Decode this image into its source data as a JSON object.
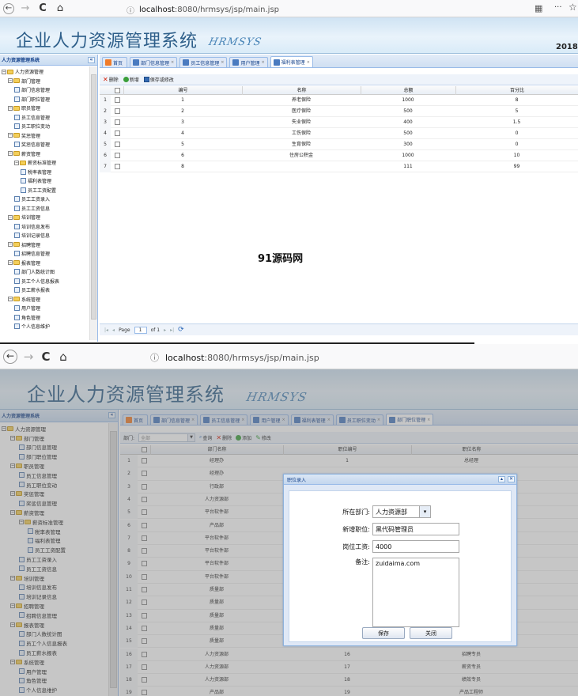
{
  "browser": {
    "back": "←",
    "forward": "→",
    "reload": "C",
    "home": "⌂",
    "url_host": "localhost",
    "url_path": ":8080/hrmsys/jsp/main.jsp",
    "qr": "▦",
    "menu": "···",
    "star": "☆",
    "info": "ⓘ"
  },
  "app": {
    "title": "企业人力资源管理系统",
    "logo": "HRMSYS",
    "year": "2018"
  },
  "sidebar": {
    "header": "人力资源管理系统",
    "collapse": "«",
    "tree": [
      {
        "label": "人力资源管理",
        "level": 0,
        "type": "folder"
      },
      {
        "label": "部门管理",
        "level": 1,
        "type": "folder"
      },
      {
        "label": "部门信息管理",
        "level": 2,
        "type": "leaf"
      },
      {
        "label": "部门职位管理",
        "level": 2,
        "type": "leaf"
      },
      {
        "label": "职员管理",
        "level": 1,
        "type": "folder"
      },
      {
        "label": "员工信息管理",
        "level": 2,
        "type": "leaf"
      },
      {
        "label": "员工职位变动",
        "level": 2,
        "type": "leaf"
      },
      {
        "label": "奖惩管理",
        "level": 1,
        "type": "folder"
      },
      {
        "label": "奖惩信息管理",
        "level": 2,
        "type": "leaf"
      },
      {
        "label": "薪资管理",
        "level": 1,
        "type": "folder"
      },
      {
        "label": "薪资标准管理",
        "level": 2,
        "type": "folder"
      },
      {
        "label": "税率表管理",
        "level": 3,
        "type": "leaf"
      },
      {
        "label": "福利表管理",
        "level": 3,
        "type": "leaf"
      },
      {
        "label": "员工工资配置",
        "level": 3,
        "type": "leaf"
      },
      {
        "label": "员工工资录入",
        "level": 2,
        "type": "leaf"
      },
      {
        "label": "员工工资信息",
        "level": 2,
        "type": "leaf"
      },
      {
        "label": "培训管理",
        "level": 1,
        "type": "folder"
      },
      {
        "label": "培训信息发布",
        "level": 2,
        "type": "leaf"
      },
      {
        "label": "培训记录信息",
        "level": 2,
        "type": "leaf"
      },
      {
        "label": "招聘管理",
        "level": 1,
        "type": "folder"
      },
      {
        "label": "招聘信息管理",
        "level": 2,
        "type": "leaf"
      },
      {
        "label": "报表管理",
        "level": 1,
        "type": "folder"
      },
      {
        "label": "部门人数统计图",
        "level": 2,
        "type": "leaf"
      },
      {
        "label": "员工个人信息报表",
        "level": 2,
        "type": "leaf"
      },
      {
        "label": "员工薪水报表",
        "level": 2,
        "type": "leaf"
      },
      {
        "label": "系统管理",
        "level": 1,
        "type": "folder"
      },
      {
        "label": "用户管理",
        "level": 2,
        "type": "leaf"
      },
      {
        "label": "角色管理",
        "level": 2,
        "type": "leaf"
      },
      {
        "label": "个人信息维护",
        "level": 2,
        "type": "leaf"
      }
    ]
  },
  "screen1": {
    "tabs": [
      {
        "label": "首页",
        "close": ""
      },
      {
        "label": "部门信息管理",
        "close": "×"
      },
      {
        "label": "员工信息管理",
        "close": "×"
      },
      {
        "label": "用户管理",
        "close": "×"
      },
      {
        "label": "福利表管理",
        "close": "×"
      }
    ],
    "toolbar": {
      "delete": "删除",
      "add": "新增",
      "save": "保存或修改"
    },
    "columns": [
      "编号",
      "名称",
      "总额",
      "百分比"
    ],
    "rows": [
      {
        "n": "1",
        "id": "1",
        "name": "养老保险",
        "total": "1000",
        "pct": "8"
      },
      {
        "n": "2",
        "id": "2",
        "name": "医疗保险",
        "total": "500",
        "pct": "5"
      },
      {
        "n": "3",
        "id": "3",
        "name": "失业保险",
        "total": "400",
        "pct": "1.5"
      },
      {
        "n": "4",
        "id": "4",
        "name": "工伤保险",
        "total": "500",
        "pct": "0"
      },
      {
        "n": "5",
        "id": "5",
        "name": "生育保险",
        "total": "300",
        "pct": "0"
      },
      {
        "n": "6",
        "id": "6",
        "name": "住房公积金",
        "total": "1000",
        "pct": "10"
      },
      {
        "n": "7",
        "id": "8",
        "name": "",
        "total": "111",
        "pct": "99"
      }
    ],
    "pager": {
      "first": "|◂",
      "prev": "◂",
      "page_label": "Page",
      "page": "1",
      "of": "of 1",
      "next": "▸",
      "last": "▸|",
      "refresh": "⟳"
    }
  },
  "watermark": "91源码网",
  "screen2": {
    "tabs": [
      {
        "label": "首页",
        "close": ""
      },
      {
        "label": "部门信息管理",
        "close": "×"
      },
      {
        "label": "员工信息管理",
        "close": "×"
      },
      {
        "label": "用户管理",
        "close": "×"
      },
      {
        "label": "福利表管理",
        "close": "×"
      },
      {
        "label": "员工职位变动",
        "close": "×"
      },
      {
        "label": "部门职位管理",
        "close": "×"
      }
    ],
    "toolbar": {
      "dept_label": "部门:",
      "dept_value": "全部",
      "query": "查询",
      "delete": "删除",
      "add": "添加",
      "edit": "修改"
    },
    "columns": [
      "部门名称",
      "职位编号",
      "职位名称"
    ],
    "rows": [
      {
        "n": "1",
        "dept": "经理办",
        "code": "1",
        "pos": "总经理"
      },
      {
        "n": "2",
        "dept": "经理办",
        "code": "",
        "pos": ""
      },
      {
        "n": "3",
        "dept": "行政部",
        "code": "",
        "pos": ""
      },
      {
        "n": "4",
        "dept": "人力资源部",
        "code": "",
        "pos": ""
      },
      {
        "n": "5",
        "dept": "平台软件部",
        "code": "",
        "pos": ""
      },
      {
        "n": "6",
        "dept": "产品部",
        "code": "",
        "pos": ""
      },
      {
        "n": "7",
        "dept": "平台软件部",
        "code": "",
        "pos": ""
      },
      {
        "n": "8",
        "dept": "平台软件部",
        "code": "",
        "pos": ""
      },
      {
        "n": "9",
        "dept": "平台软件部",
        "code": "",
        "pos": ""
      },
      {
        "n": "10",
        "dept": "平台软件部",
        "code": "",
        "pos": ""
      },
      {
        "n": "11",
        "dept": "质量部",
        "code": "",
        "pos": ""
      },
      {
        "n": "12",
        "dept": "质量部",
        "code": "",
        "pos": ""
      },
      {
        "n": "13",
        "dept": "质量部",
        "code": "",
        "pos": ""
      },
      {
        "n": "14",
        "dept": "质量部",
        "code": "",
        "pos": ""
      },
      {
        "n": "15",
        "dept": "质量部",
        "code": "",
        "pos": ""
      },
      {
        "n": "16",
        "dept": "人力资源部",
        "code": "16",
        "pos": "招聘专员"
      },
      {
        "n": "17",
        "dept": "人力资源部",
        "code": "17",
        "pos": "薪资专员"
      },
      {
        "n": "18",
        "dept": "人力资源部",
        "code": "18",
        "pos": "绩效专员"
      },
      {
        "n": "19",
        "dept": "产品部",
        "code": "19",
        "pos": "产品工程师"
      }
    ]
  },
  "dialog": {
    "title": "职位录入",
    "collapse": "▴",
    "close": "✕",
    "dept_label": "所在部门:",
    "dept_value": "人力资源部",
    "pos_label": "新增职位:",
    "pos_value": "黑代码管理员",
    "salary_label": "岗位工资:",
    "salary_value": "4000",
    "note_label": "备注:",
    "note_value": "zuidaima.com",
    "save": "保存",
    "close_btn": "关闭"
  }
}
